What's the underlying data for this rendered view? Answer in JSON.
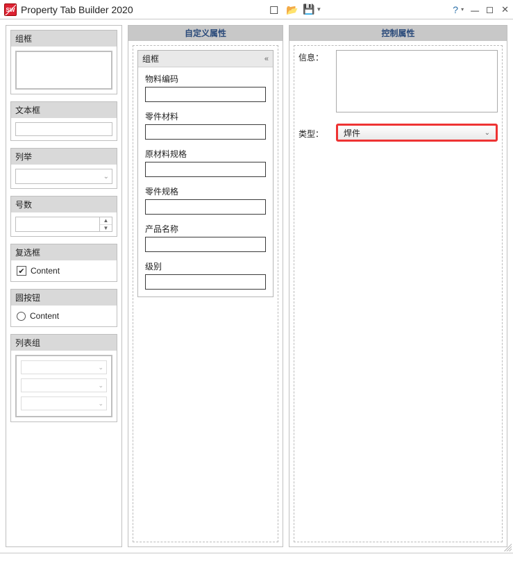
{
  "title": "Property Tab Builder 2020",
  "columns": {
    "middle_header": "自定义属性",
    "right_header": "控制属性"
  },
  "palette": {
    "group": "组框",
    "textbox": "文本框",
    "list": "列举",
    "number": "号数",
    "checkbox": "复选框",
    "checkbox_sample": "Content",
    "radio": "圆按钮",
    "radio_sample": "Content",
    "listgroup": "列表组"
  },
  "form": {
    "groupbox_label": "组框",
    "fields": [
      "物料编码",
      "零件材料",
      "原材料规格",
      "零件规格",
      "产品名称",
      "级别"
    ]
  },
  "control": {
    "info_label": "信息：",
    "type_label": "类型：",
    "type_value": "焊件"
  }
}
